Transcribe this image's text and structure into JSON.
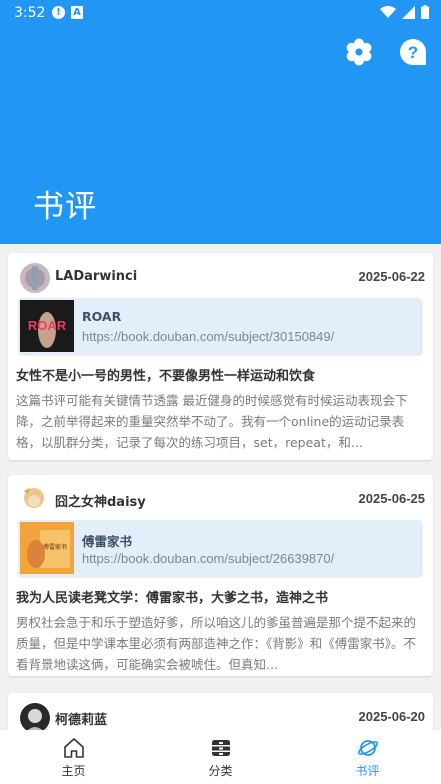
{
  "status_bar": {
    "time": "3:52",
    "alert_glyph": "!",
    "a_glyph": "A"
  },
  "header": {
    "title": "书评"
  },
  "reviews": [
    {
      "username": "LADarwinci",
      "date": "2025-06-22",
      "book_title": "ROAR",
      "book_url": "https://book.douban.com/subject/30150849/",
      "cover_text": "ROAR",
      "review_title": "女性不是小一号的男性，不要像男性一样运动和饮食",
      "review_body": "这篇书评可能有关键情节透露 最近健身的时候感觉有时候运动表现会下降，之前举得起来的重量突然举不动了。我有一个online的运动记录表格，以肌群分类，记录了每次的练习项目，set，repeat，和..."
    },
    {
      "username": "囧之女神daisy",
      "date": "2025-06-25",
      "book_title": "傅雷家书",
      "book_url": "https://book.douban.com/subject/26639870/",
      "cover_text": "傅雷家书",
      "review_title": "我为人民读老凳文学：傅雷家书，大爹之书，造神之书",
      "review_body": "男权社会急于和乐于塑造好爹，所以咱这儿的爹虽普遍是那个提不起来的质量，但是中学课本里必须有两部造神之作：《背影》和《傅雷家书》。不看背景地读这俩，可能确实会被唬住。但真知..."
    },
    {
      "username": "柯德莉蓝",
      "date": "2025-06-20"
    }
  ],
  "bottom_nav": [
    {
      "label": "主页",
      "icon": "home-icon"
    },
    {
      "label": "分类",
      "icon": "category-icon"
    },
    {
      "label": "书评",
      "icon": "planet-icon"
    }
  ],
  "colors": {
    "primary": "#2196f3",
    "link_bg": "#e3eefb"
  }
}
